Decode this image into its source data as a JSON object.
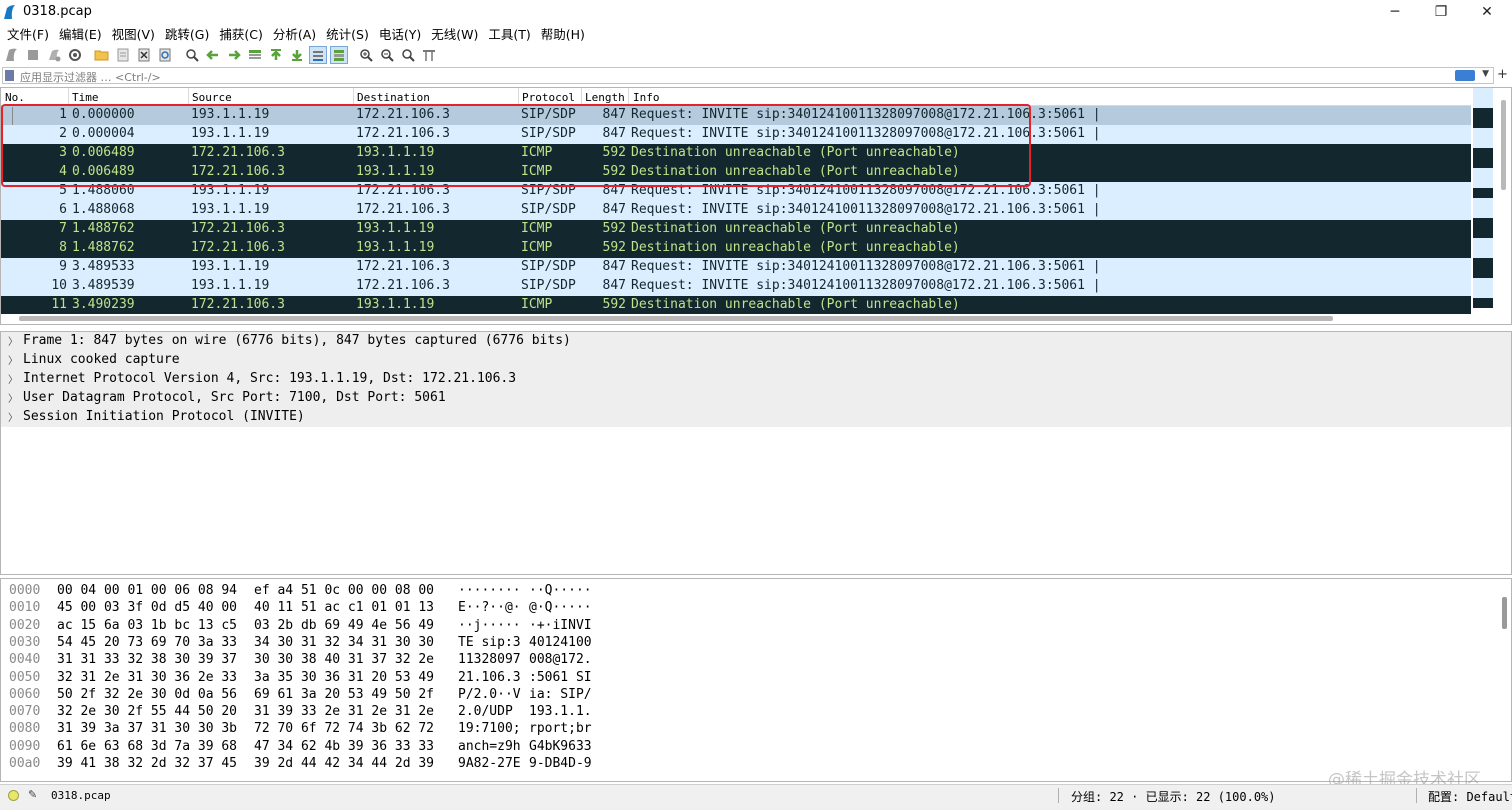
{
  "window": {
    "title": "0318.pcap",
    "minimize": "─",
    "restore": "❐",
    "close": "✕"
  },
  "menu": [
    "文件(F)",
    "编辑(E)",
    "视图(V)",
    "跳转(G)",
    "捕获(C)",
    "分析(A)",
    "统计(S)",
    "电话(Y)",
    "无线(W)",
    "工具(T)",
    "帮助(H)"
  ],
  "filter": {
    "placeholder": "应用显示过滤器 … <Ctrl-/>",
    "add": "+"
  },
  "packet_list": {
    "columns": [
      "No.",
      "Time",
      "Source",
      "Destination",
      "Protocol",
      "Length",
      "Info"
    ],
    "rows": [
      {
        "no": "1",
        "time": "0.000000",
        "src": "193.1.1.19",
        "dst": "172.21.106.3",
        "proto": "SIP/SDP",
        "len": "847",
        "info": "Request: INVITE sip:34012410011328097008@172.21.106.3:5061 |",
        "kind": "sip",
        "selected": true
      },
      {
        "no": "2",
        "time": "0.000004",
        "src": "193.1.1.19",
        "dst": "172.21.106.3",
        "proto": "SIP/SDP",
        "len": "847",
        "info": "Request: INVITE sip:34012410011328097008@172.21.106.3:5061 |",
        "kind": "sip"
      },
      {
        "no": "3",
        "time": "0.006489",
        "src": "172.21.106.3",
        "dst": "193.1.1.19",
        "proto": "ICMP",
        "len": "592",
        "info": "Destination unreachable (Port unreachable)",
        "kind": "icmp"
      },
      {
        "no": "4",
        "time": "0.006489",
        "src": "172.21.106.3",
        "dst": "193.1.1.19",
        "proto": "ICMP",
        "len": "592",
        "info": "Destination unreachable (Port unreachable)",
        "kind": "icmp"
      },
      {
        "no": "5",
        "time": "1.488060",
        "src": "193.1.1.19",
        "dst": "172.21.106.3",
        "proto": "SIP/SDP",
        "len": "847",
        "info": "Request: INVITE sip:34012410011328097008@172.21.106.3:5061 |",
        "kind": "sip"
      },
      {
        "no": "6",
        "time": "1.488068",
        "src": "193.1.1.19",
        "dst": "172.21.106.3",
        "proto": "SIP/SDP",
        "len": "847",
        "info": "Request: INVITE sip:34012410011328097008@172.21.106.3:5061 |",
        "kind": "sip"
      },
      {
        "no": "7",
        "time": "1.488762",
        "src": "172.21.106.3",
        "dst": "193.1.1.19",
        "proto": "ICMP",
        "len": "592",
        "info": "Destination unreachable (Port unreachable)",
        "kind": "icmp"
      },
      {
        "no": "8",
        "time": "1.488762",
        "src": "172.21.106.3",
        "dst": "193.1.1.19",
        "proto": "ICMP",
        "len": "592",
        "info": "Destination unreachable (Port unreachable)",
        "kind": "icmp"
      },
      {
        "no": "9",
        "time": "3.489533",
        "src": "193.1.1.19",
        "dst": "172.21.106.3",
        "proto": "SIP/SDP",
        "len": "847",
        "info": "Request: INVITE sip:34012410011328097008@172.21.106.3:5061 |",
        "kind": "sip"
      },
      {
        "no": "10",
        "time": "3.489539",
        "src": "193.1.1.19",
        "dst": "172.21.106.3",
        "proto": "SIP/SDP",
        "len": "847",
        "info": "Request: INVITE sip:34012410011328097008@172.21.106.3:5061 |",
        "kind": "sip"
      },
      {
        "no": "11",
        "time": "3.490239",
        "src": "172.21.106.3",
        "dst": "193.1.1.19",
        "proto": "ICMP",
        "len": "592",
        "info": "Destination unreachable (Port unreachable)",
        "kind": "icmp"
      }
    ]
  },
  "details": [
    "Frame 1: 847 bytes on wire (6776 bits), 847 bytes captured (6776 bits)",
    "Linux cooked capture",
    "Internet Protocol Version 4, Src: 193.1.1.19, Dst: 172.21.106.3",
    "User Datagram Protocol, Src Port: 7100, Dst Port: 5061",
    "Session Initiation Protocol (INVITE)"
  ],
  "bytes": [
    {
      "off": "0000",
      "h1": "00 04 00 01 00 06 08 94",
      "h2": "ef a4 51 0c 00 00 08 00",
      "a1": "········",
      "a2": "··Q·····"
    },
    {
      "off": "0010",
      "h1": "45 00 03 3f 0d d5 40 00",
      "h2": "40 11 51 ac c1 01 01 13",
      "a1": "E··?··@·",
      "a2": "@·Q·····"
    },
    {
      "off": "0020",
      "h1": "ac 15 6a 03 1b bc 13 c5",
      "h2": "03 2b db 69 49 4e 56 49",
      "a1": "··j·····",
      "a2": "·+·iINVI"
    },
    {
      "off": "0030",
      "h1": "54 45 20 73 69 70 3a 33",
      "h2": "34 30 31 32 34 31 30 30",
      "a1": "TE sip:3",
      "a2": "40124100"
    },
    {
      "off": "0040",
      "h1": "31 31 33 32 38 30 39 37",
      "h2": "30 30 38 40 31 37 32 2e",
      "a1": "11328097",
      "a2": "008@172."
    },
    {
      "off": "0050",
      "h1": "32 31 2e 31 30 36 2e 33",
      "h2": "3a 35 30 36 31 20 53 49",
      "a1": "21.106.3",
      "a2": ":5061 SI"
    },
    {
      "off": "0060",
      "h1": "50 2f 32 2e 30 0d 0a 56",
      "h2": "69 61 3a 20 53 49 50 2f",
      "a1": "P/2.0··V",
      "a2": "ia: SIP/"
    },
    {
      "off": "0070",
      "h1": "32 2e 30 2f 55 44 50 20",
      "h2": "31 39 33 2e 31 2e 31 2e",
      "a1": "2.0/UDP ",
      "a2": "193.1.1."
    },
    {
      "off": "0080",
      "h1": "31 39 3a 37 31 30 30 3b",
      "h2": "72 70 6f 72 74 3b 62 72",
      "a1": "19:7100;",
      "a2": "rport;br"
    },
    {
      "off": "0090",
      "h1": "61 6e 63 68 3d 7a 39 68",
      "h2": "47 34 62 4b 39 36 33 33",
      "a1": "anch=z9h",
      "a2": "G4bK9633"
    },
    {
      "off": "00a0",
      "h1": "39 41 38 32 2d 32 37 45",
      "h2": "39 2d 44 42 34 44 2d 39",
      "a1": "9A82-27E",
      "a2": "9-DB4D-9"
    }
  ],
  "status": {
    "file": "0318.pcap",
    "stats": "分组: 22 · 已显示: 22 (100.0%)",
    "profile": "配置: Default"
  },
  "watermark": "@稀土掘金技术社区",
  "colors": {
    "sip_bg": "#daeeff",
    "sip_selected_bg": "#b5cadc",
    "icmp_bg": "#12272e",
    "icmp_fg": "#bde38b",
    "highlight": "#e5222a"
  },
  "toolbar_icons": [
    "start-capture-icon",
    "stop-capture-icon",
    "restart-capture-icon",
    "capture-options-icon",
    "open-file-icon",
    "save-file-icon",
    "close-file-icon",
    "reload-file-icon",
    "find-packet-icon",
    "go-back-icon",
    "go-forward-icon",
    "go-to-packet-icon",
    "go-first-icon",
    "go-last-icon",
    "autoscroll-icon",
    "colorize-icon",
    "zoom-in-icon",
    "zoom-out-icon",
    "zoom-normal-icon",
    "resize-columns-icon"
  ]
}
